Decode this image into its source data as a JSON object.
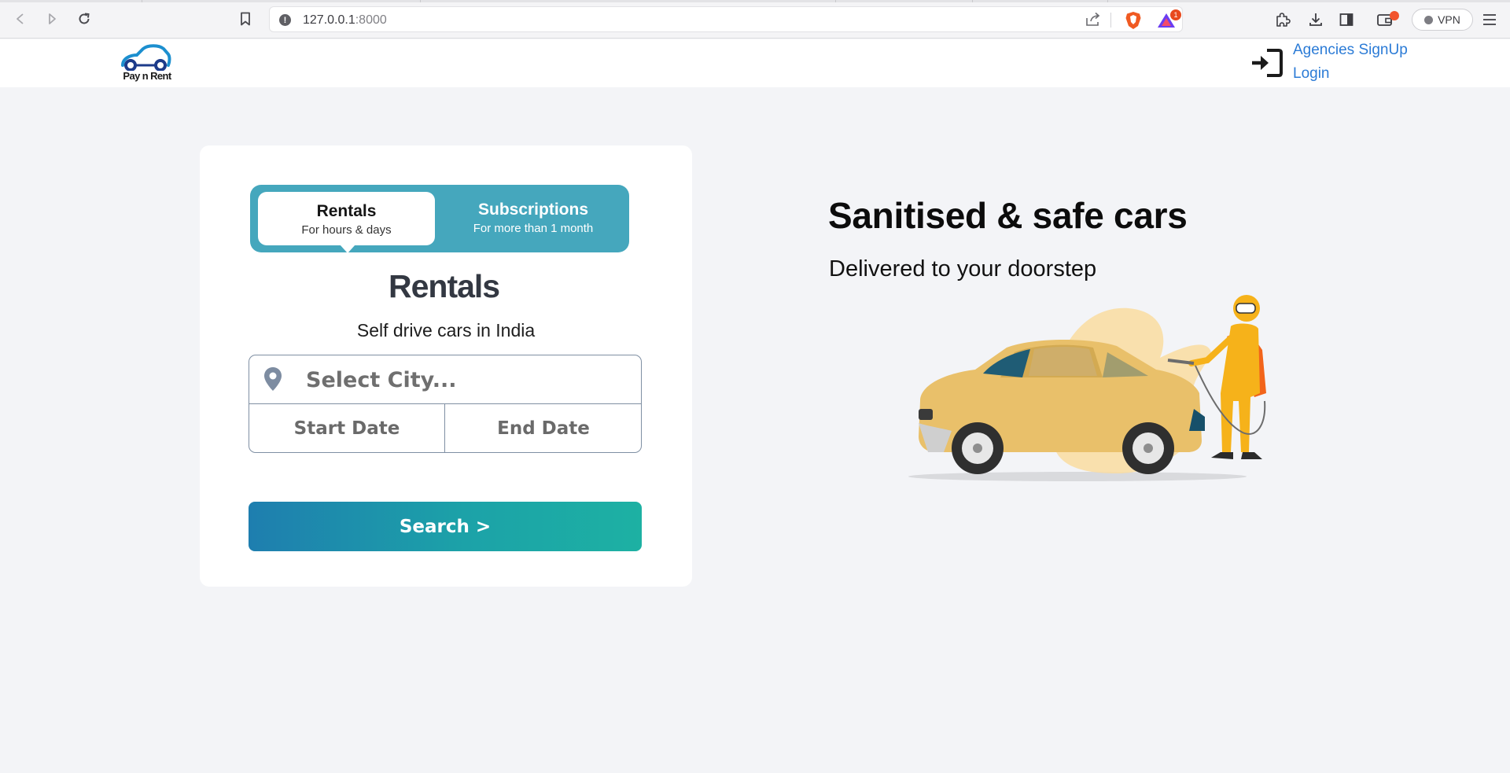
{
  "browser": {
    "url_host": "127.0.0.1",
    "url_port": ":8000",
    "rewards_count": "1",
    "vpn_label": "VPN"
  },
  "header": {
    "logo_text": "Pay n Rent",
    "signup_label": "Agencies SignUp",
    "login_label": "Login"
  },
  "search_card": {
    "tabs": [
      {
        "title": "Rentals",
        "subtitle": "For hours & days",
        "active": true
      },
      {
        "title": "Subscriptions",
        "subtitle": "For more than 1 month",
        "active": false
      }
    ],
    "brand_logo": "Rentals",
    "tagline": "Self drive cars in India",
    "city_placeholder": "Select City...",
    "start_date_label": "Start Date",
    "end_date_label": "End Date",
    "search_label": "Search >"
  },
  "hero": {
    "title": "Sanitised & safe cars",
    "subtitle": "Delivered to your doorstep"
  },
  "colors": {
    "tab_bg": "#45a7bd",
    "link": "#2b7bd6",
    "search_gradient_start": "#1e7eaf",
    "search_gradient_end": "#1db1a3",
    "page_bg": "#f3f4f7"
  }
}
